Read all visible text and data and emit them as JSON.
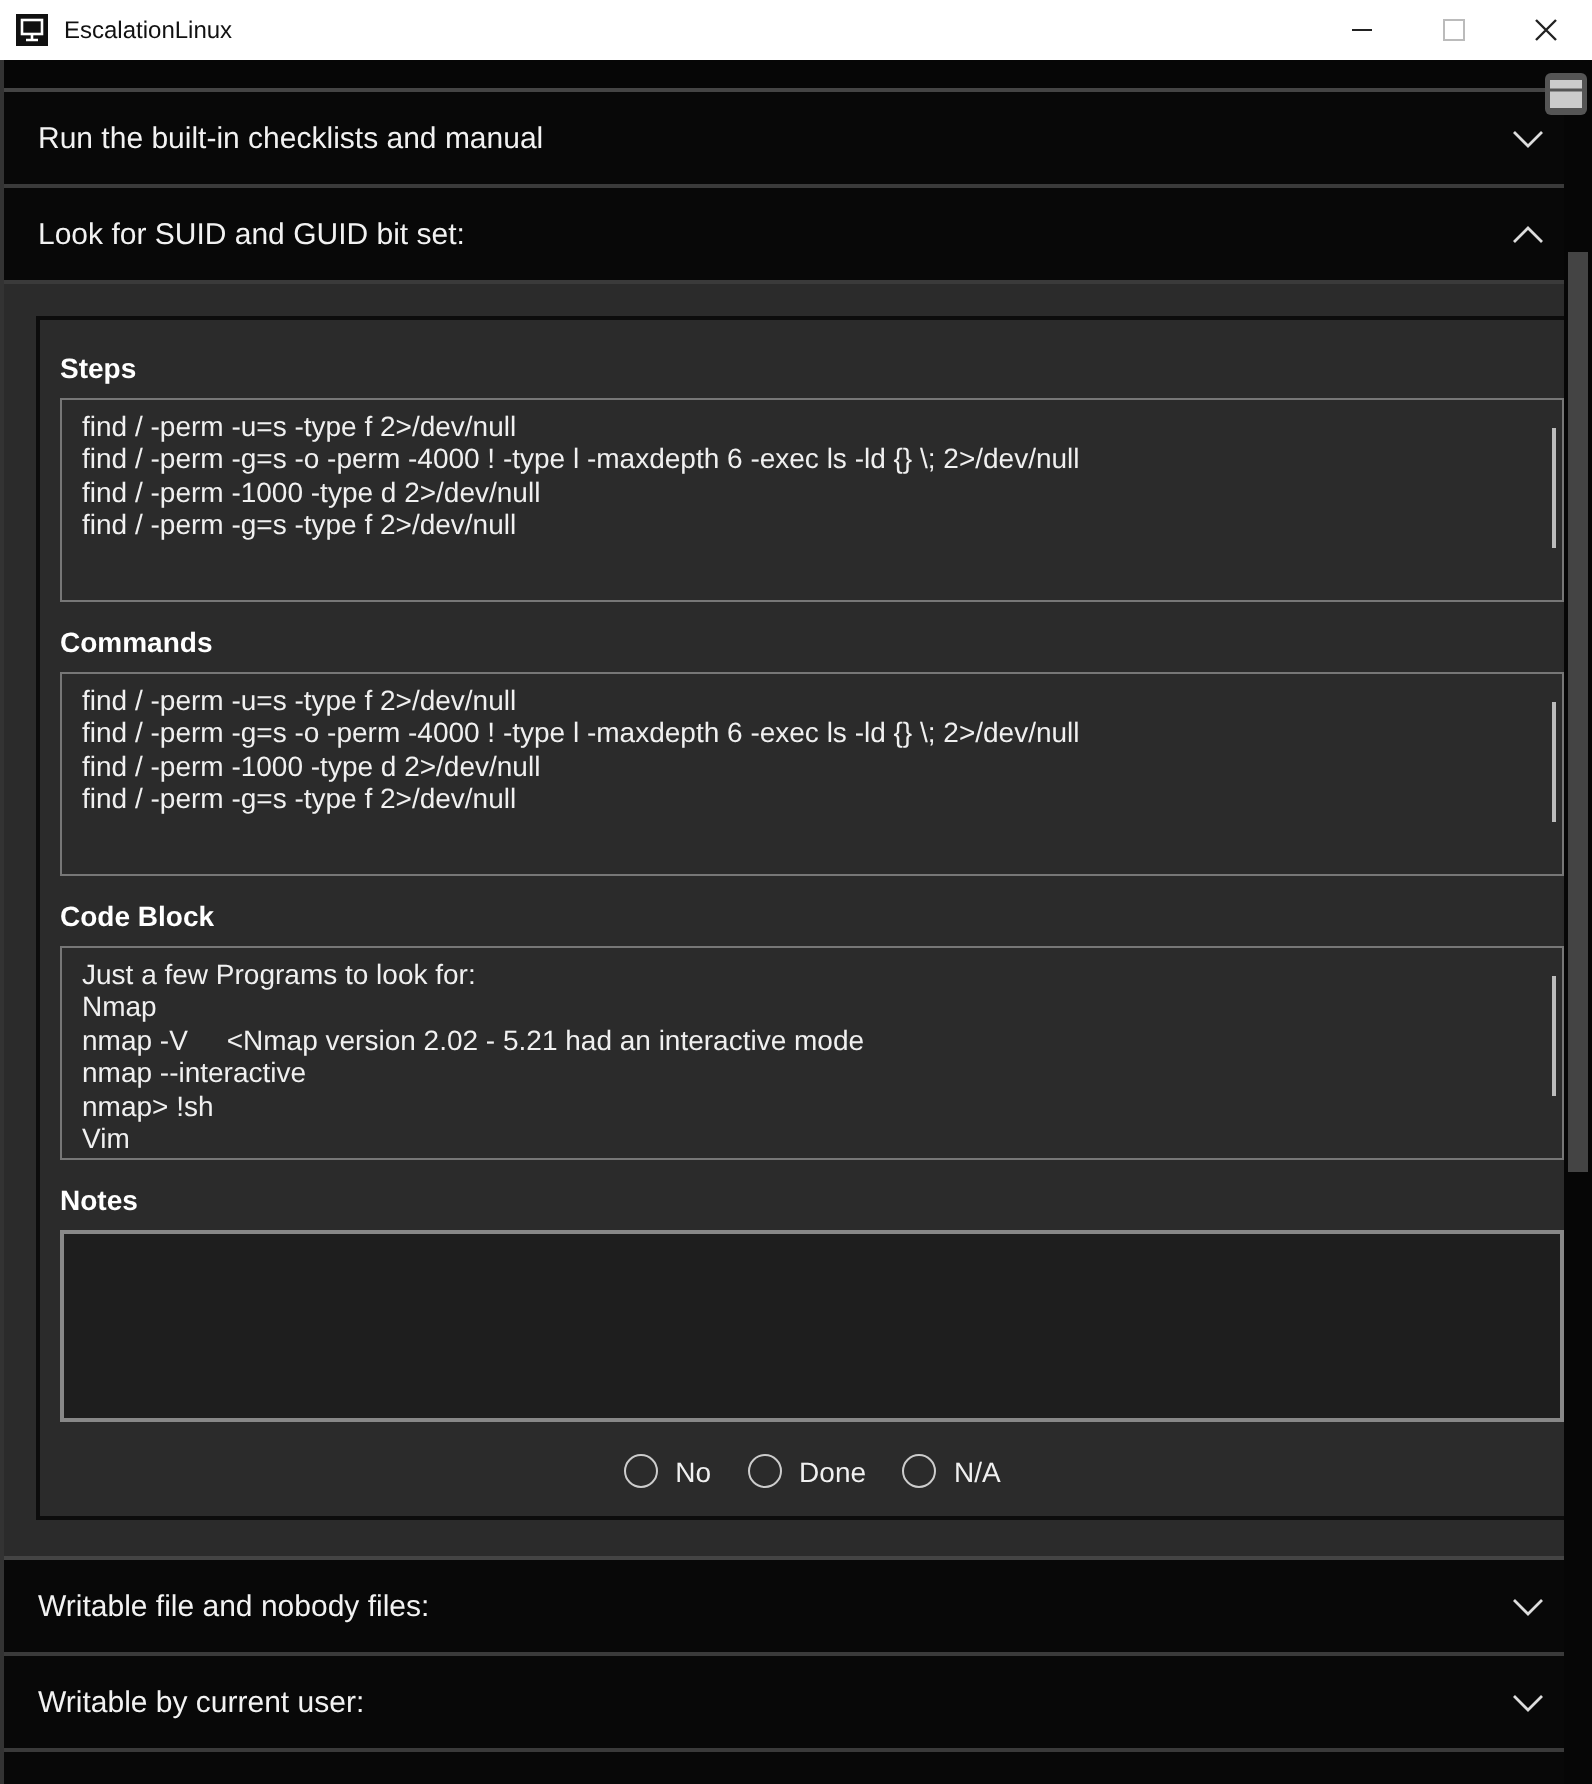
{
  "window": {
    "title": "EscalationLinux"
  },
  "sections": [
    {
      "title": "Run the built-in checklists and manual",
      "expanded": false
    },
    {
      "title": "Look for SUID and GUID bit set:",
      "expanded": true,
      "fields": [
        {
          "label": "Steps",
          "lines": [
            "find / -perm -u=s -type f 2>/dev/null",
            "find / -perm -g=s -o -perm -4000 ! -type l -maxdepth 6 -exec ls -ld {} \\; 2>/dev/null",
            "find / -perm -1000 -type d 2>/dev/null",
            "find / -perm -g=s -type f 2>/dev/null"
          ]
        },
        {
          "label": "Commands",
          "lines": [
            "find / -perm -u=s -type f 2>/dev/null",
            "find / -perm -g=s -o -perm -4000 ! -type l -maxdepth 6 -exec ls -ld {} \\; 2>/dev/null",
            "find / -perm -1000 -type d 2>/dev/null",
            "find / -perm -g=s -type f 2>/dev/null"
          ]
        },
        {
          "label": "Code Block",
          "lines": [
            "Just a few Programs to look for:",
            "Nmap",
            "nmap -V     <Nmap version 2.02 - 5.21 had an interactive mode",
            "nmap --interactive",
            "nmap> !sh",
            "Vim"
          ]
        }
      ],
      "notes_label": "Notes",
      "status": [
        {
          "label": "No",
          "selected": false
        },
        {
          "label": "Done",
          "selected": false
        },
        {
          "label": "N/A",
          "selected": false
        }
      ]
    },
    {
      "title": "Writable file and nobody files:",
      "expanded": false
    },
    {
      "title": "Writable by current user:",
      "expanded": false
    }
  ]
}
